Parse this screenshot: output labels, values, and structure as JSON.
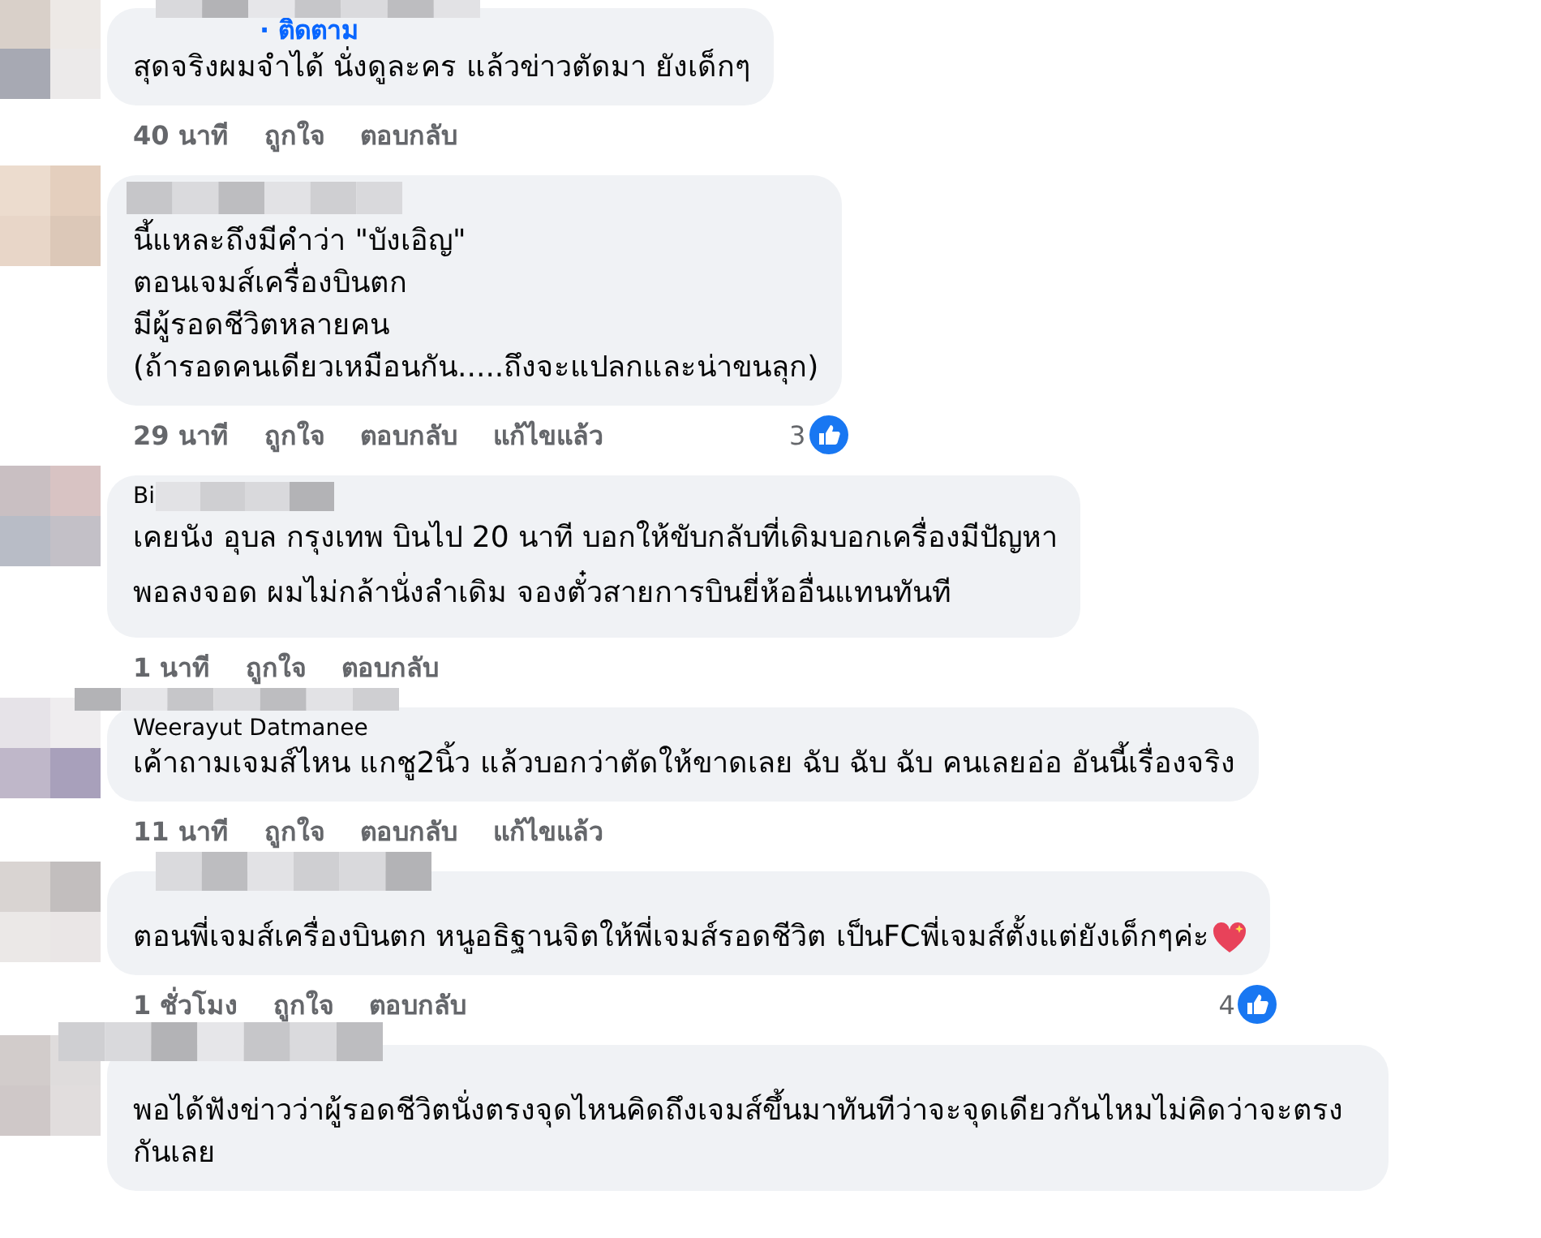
{
  "comments": [
    {
      "follow": "· ติดตาม",
      "lines": [
        "สุดจริงผมจำได้ นั่งดูละคร แล้วข่าวตัดมา ยังเด็กๆ"
      ],
      "time": "40 นาที",
      "like": "ถูกใจ",
      "reply": "ตอบกลับ"
    },
    {
      "lines": [
        "นี้แหละถึงมีคำว่า \"บังเอิญ\"",
        "ตอนเจมส์เครื่องบินตก",
        "มีผู้รอดชีวิตหลายคน",
        "(ถ้ารอดคนเดียวเหมือนกัน.....ถึงจะแปลกและน่าขนลุก)"
      ],
      "time": "29 นาที",
      "like": "ถูกใจ",
      "reply": "ตอบกลับ",
      "edited": "แก้ไขแล้ว",
      "reactions": "3"
    },
    {
      "name": "Bi",
      "lines": [
        "เคยนัง อุบล กรุงเทพ บินไป 20 นาที บอกให้ขับกลับที่เดิมบอกเครื่องมีปัญหา",
        "พอลงจอด ผมไม่กล้านั่งลำเดิม จองตั๋วสายการบินยี่ห้ออื่นแทนทันที"
      ],
      "spaced": true,
      "time": "1 นาที",
      "like": "ถูกใจ",
      "reply": "ตอบกลับ"
    },
    {
      "name": "Weerayut Datmanee",
      "lines": [
        "เค้าถามเจมส์ไหน แกชู2นิ้ว แล้วบอกว่าตัดให้ขาดเลย ฉับ ฉับ ฉับ คนเลยอ่อ อันนี้เรื่องจริง"
      ],
      "time": "11 นาที",
      "like": "ถูกใจ",
      "reply": "ตอบกลับ",
      "edited": "แก้ไขแล้ว"
    },
    {
      "lines": [
        "ตอนพี่เจมส์เครื่องบินตก หนูอธิฐานจิตให้พี่เจมส์รอดชีวิต เป็นFCพี่เจมส์ตั้งแต่ยังเด็กๆค่ะ"
      ],
      "heart": true,
      "time": "1 ชั่วโมง",
      "like": "ถูกใจ",
      "reply": "ตอบกลับ",
      "reactions": "4"
    },
    {
      "lines": [
        "พอได้ฟังข่าวว่าผู้รอดชีวิตนั่งตรงจุดไหนคิดถึงเจมส์ขึ้นมาทันทีว่าจะจุดเดียวกันไหมไม่คิดว่าจะตรงกันเลย"
      ]
    }
  ]
}
